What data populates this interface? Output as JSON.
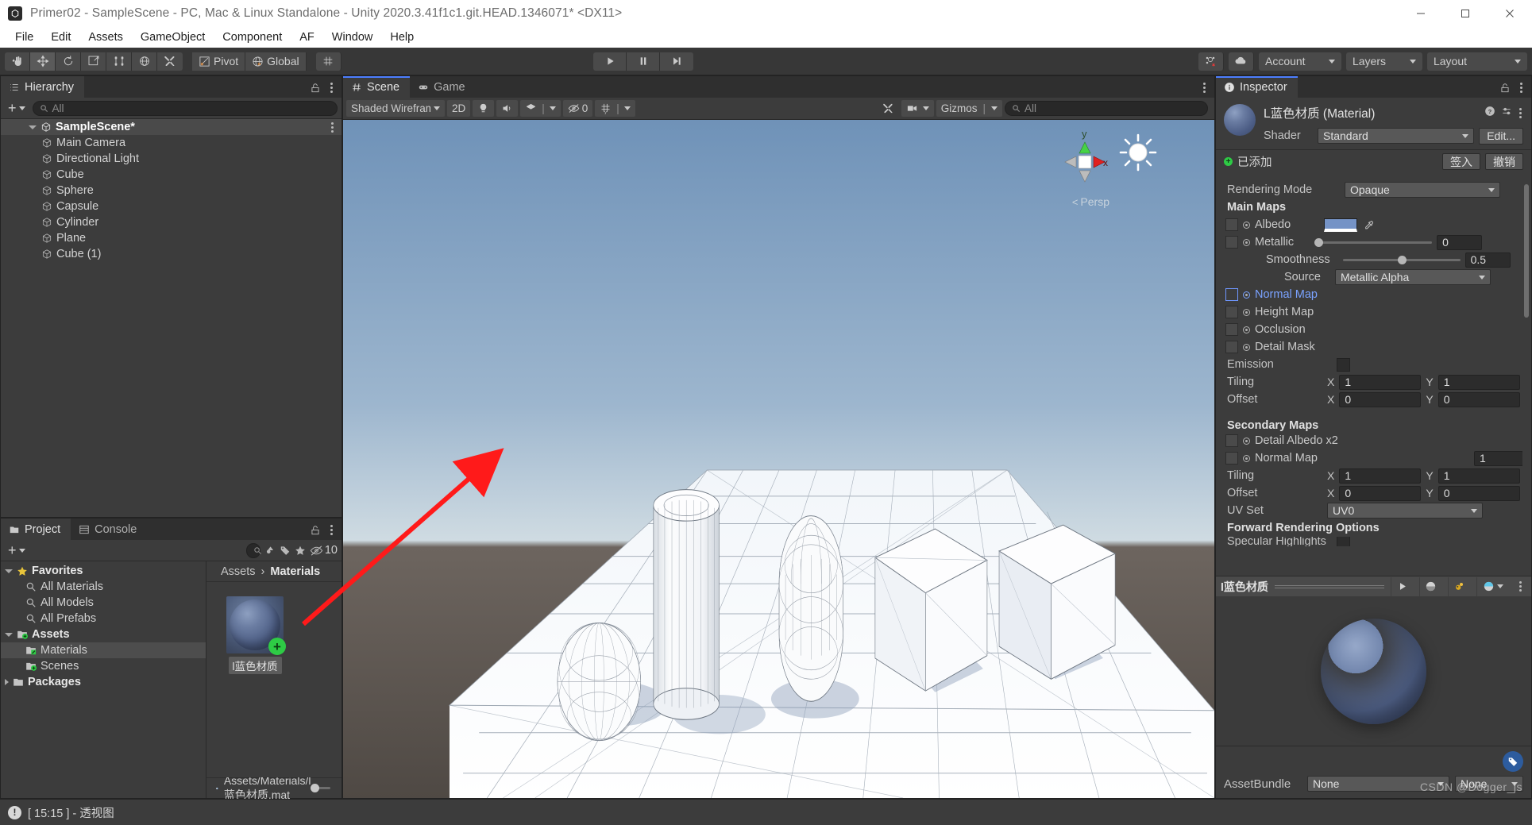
{
  "window": {
    "title": "Primer02 - SampleScene - PC, Mac & Linux Standalone - Unity 2020.3.41f1c1.git.HEAD.1346071* <DX11>",
    "app_icon": "unity-icon",
    "minimize": "minimize-icon",
    "maximize": "maximize-icon",
    "close": "close-icon"
  },
  "menubar": {
    "items": [
      "File",
      "Edit",
      "Assets",
      "GameObject",
      "Component",
      "AF",
      "Window",
      "Help"
    ]
  },
  "toolbar": {
    "tools": [
      {
        "name": "hand-tool",
        "icon": "hand-icon",
        "active": false
      },
      {
        "name": "move-tool",
        "icon": "move-icon",
        "active": true
      },
      {
        "name": "rotate-tool",
        "icon": "rotate-icon",
        "active": false
      },
      {
        "name": "scale-tool",
        "icon": "scale-icon",
        "active": false
      },
      {
        "name": "rect-tool",
        "icon": "rect-icon",
        "active": false
      },
      {
        "name": "transform-tool",
        "icon": "transform-icon",
        "active": false
      },
      {
        "name": "custom-tool",
        "icon": "wrench-icon",
        "active": false
      }
    ],
    "pivot_label": "Pivot",
    "global_label": "Global",
    "grid_icon": "grid-snap-icon",
    "play_label": "play-icon",
    "pause_label": "pause-icon",
    "step_label": "step-icon",
    "collab_icon": "collab-icon",
    "cloud_icon": "cloud-icon",
    "account_label": "Account",
    "layers_label": "Layers",
    "layout_label": "Layout"
  },
  "hierarchy": {
    "tab_label": "Hierarchy",
    "tab_icon": "hierarchy-icon",
    "search_placeholder": "All",
    "search_value": "",
    "scene_name": "SampleScene*",
    "items": [
      {
        "label": "Main Camera"
      },
      {
        "label": "Directional Light"
      },
      {
        "label": "Cube"
      },
      {
        "label": "Sphere"
      },
      {
        "label": "Capsule"
      },
      {
        "label": "Cylinder"
      },
      {
        "label": "Plane"
      },
      {
        "label": "Cube (1)"
      }
    ]
  },
  "scene": {
    "tabs": [
      {
        "label": "Scene",
        "icon": "scene-grid-icon",
        "active": true
      },
      {
        "label": "Game",
        "icon": "gamepad-icon",
        "active": false
      }
    ],
    "draw_mode": "Shaded Wireframe",
    "mode_2d": "2D",
    "lighting_icon": "lightbulb-icon",
    "audio_icon": "speaker-icon",
    "fx_icon": "fx-icon",
    "hidden_count": "0",
    "grid_icon": "grid-icon",
    "tool_icon": "wrench-icon",
    "camera_icon": "camera-icon",
    "gizmos_label": "Gizmos",
    "search_placeholder": "All",
    "search_value": "",
    "gizmo_axes": {
      "y": "y",
      "x": "x"
    },
    "persp_label": "Persp"
  },
  "project": {
    "tabs": [
      {
        "label": "Project",
        "icon": "folder-icon",
        "active": true
      },
      {
        "label": "Console",
        "icon": "console-icon",
        "active": false
      }
    ],
    "search_placeholder": "",
    "search_value": "",
    "hidden_count": "10",
    "tree": [
      {
        "label": "Favorites",
        "type": "root",
        "icon": "star-icon",
        "expanded": true,
        "indent": 0
      },
      {
        "label": "All Materials",
        "type": "search",
        "icon": "search-icon",
        "indent": 1
      },
      {
        "label": "All Models",
        "type": "search",
        "icon": "search-icon",
        "indent": 1
      },
      {
        "label": "All Prefabs",
        "type": "search",
        "icon": "search-icon",
        "indent": 1
      },
      {
        "label": "Assets",
        "type": "root",
        "icon": "folder-add-icon",
        "expanded": true,
        "indent": 0
      },
      {
        "label": "Materials",
        "type": "folder",
        "icon": "folder-mod-icon",
        "indent": 1,
        "selected": true
      },
      {
        "label": "Scenes",
        "type": "folder",
        "icon": "folder-add-icon",
        "indent": 1
      },
      {
        "label": "Packages",
        "type": "root",
        "icon": "folder-icon",
        "expanded": false,
        "indent": 0
      }
    ],
    "breadcrumb": [
      "Assets",
      "Materials"
    ],
    "assets": [
      {
        "label": "l蓝色材质",
        "badge": "+",
        "kind": "material"
      }
    ],
    "status_path": "Assets/Materials/l蓝色材质.mat",
    "zoom_value": "",
    "toolbar_icons": [
      "object-filter-icon",
      "label-filter-icon",
      "favorite-icon"
    ]
  },
  "inspector": {
    "tab_label": "Inspector",
    "tab_icon": "info-icon",
    "asset_title": "L蓝色材质 (Material)",
    "help_icon": "help-icon",
    "preset_icon": "preset-icon",
    "shader_label": "Shader",
    "shader_value": "Standard",
    "edit_label": "Edit...",
    "added_label": "已添加",
    "checkin_label": "签入",
    "revert_label": "撤销",
    "rendering_mode_label": "Rendering Mode",
    "rendering_mode_value": "Opaque",
    "main_maps_label": "Main Maps",
    "albedo_label": "Albedo",
    "albedo_color": "#7593c6",
    "metallic_label": "Metallic",
    "metallic_value": "0",
    "smoothness_label": "Smoothness",
    "smoothness_value": "0.5",
    "source_label": "Source",
    "source_value": "Metallic Alpha",
    "normal_map_label": "Normal Map",
    "height_map_label": "Height Map",
    "occlusion_label": "Occlusion",
    "detail_mask_label": "Detail Mask",
    "emission_label": "Emission",
    "tiling_label": "Tiling",
    "offset_label": "Offset",
    "tiling_x": "1",
    "tiling_y": "1",
    "offset_x": "0",
    "offset_y": "0",
    "secondary_maps_label": "Secondary Maps",
    "detail_albedo_label": "Detail Albedo x2",
    "sec_normal_label": "Normal Map",
    "sec_normal_value": "1",
    "sec_tiling_x": "1",
    "sec_tiling_y": "1",
    "sec_offset_x": "0",
    "sec_offset_y": "0",
    "uv_set_label": "UV Set",
    "uv_set_value": "UV0",
    "forward_label": "Forward Rendering Options",
    "specular_label": "Specular Highlights",
    "axis_x": "X",
    "axis_y": "Y",
    "preview_title": "l蓝色材质",
    "preview_buttons": [
      "play-icon",
      "sphere-icon",
      "lighting-icon",
      "shading-icon"
    ],
    "assetbundle_label": "AssetBundle",
    "assetbundle_value": "None",
    "assetbundle_variant": "None",
    "tag_icon": "tag-icon"
  },
  "statusbar": {
    "icon": "warning-icon",
    "message": "[ 15:15 ] - 透视图"
  },
  "watermark": "CSDN @Dogger_js",
  "colors": {
    "accent_blue": "#4c7eff",
    "material_blue": "#5b6f9b",
    "arrow_red": "#ff1a1a",
    "added_green": "#2ecb45"
  }
}
